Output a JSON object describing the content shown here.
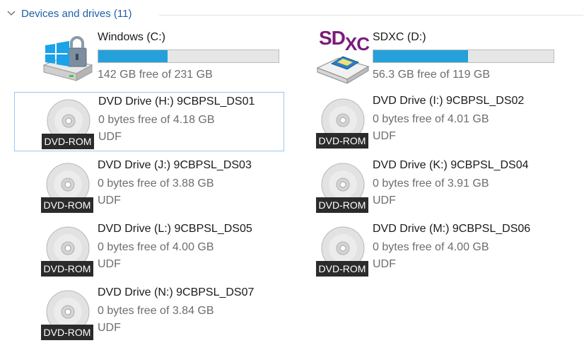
{
  "group": {
    "title": "Devices and drives (11)"
  },
  "drives": [
    {
      "name": "Windows (C:)",
      "free_text": "142 GB free of 231 GB",
      "used_fraction": 0.385,
      "icon": "windows-drive-icon"
    },
    {
      "name": "SDXC (D:)",
      "free_text": "56.3 GB free of 119 GB",
      "used_fraction": 0.527,
      "icon": "sdxc-card-icon",
      "logo_text": "SD",
      "logo_sub": "XC"
    },
    {
      "name": "DVD Drive (H:) 9CBPSL_DS01",
      "free_text": "0 bytes free of 4.18 GB",
      "fs": "UDF",
      "badge": "DVD-ROM",
      "icon": "dvd-disc-icon"
    },
    {
      "name": "DVD Drive (I:) 9CBPSL_DS02",
      "free_text": "0 bytes free of 4.01 GB",
      "fs": "UDF",
      "badge": "DVD-ROM",
      "icon": "dvd-disc-icon"
    },
    {
      "name": "DVD Drive (J:) 9CBPSL_DS03",
      "free_text": "0 bytes free of 3.88 GB",
      "fs": "UDF",
      "badge": "DVD-ROM",
      "icon": "dvd-disc-icon"
    },
    {
      "name": "DVD Drive (K:) 9CBPSL_DS04",
      "free_text": "0 bytes free of 3.91 GB",
      "fs": "UDF",
      "badge": "DVD-ROM",
      "icon": "dvd-disc-icon"
    },
    {
      "name": "DVD Drive (L:) 9CBPSL_DS05",
      "free_text": "0 bytes free of 4.00 GB",
      "fs": "UDF",
      "badge": "DVD-ROM",
      "icon": "dvd-disc-icon"
    },
    {
      "name": "DVD Drive (M:) 9CBPSL_DS06",
      "free_text": "0 bytes free of 4.00 GB",
      "fs": "UDF",
      "badge": "DVD-ROM",
      "icon": "dvd-disc-icon"
    },
    {
      "name": "DVD Drive (N:) 9CBPSL_DS07",
      "free_text": "0 bytes free of 3.84 GB",
      "fs": "UDF",
      "badge": "DVD-ROM",
      "icon": "dvd-disc-icon"
    }
  ],
  "colors": {
    "accent_bar": "#26a0da",
    "header_text": "#1e5fa9",
    "selection_border": "#99c9ef",
    "sdxc_logo": "#7b1b7b"
  }
}
